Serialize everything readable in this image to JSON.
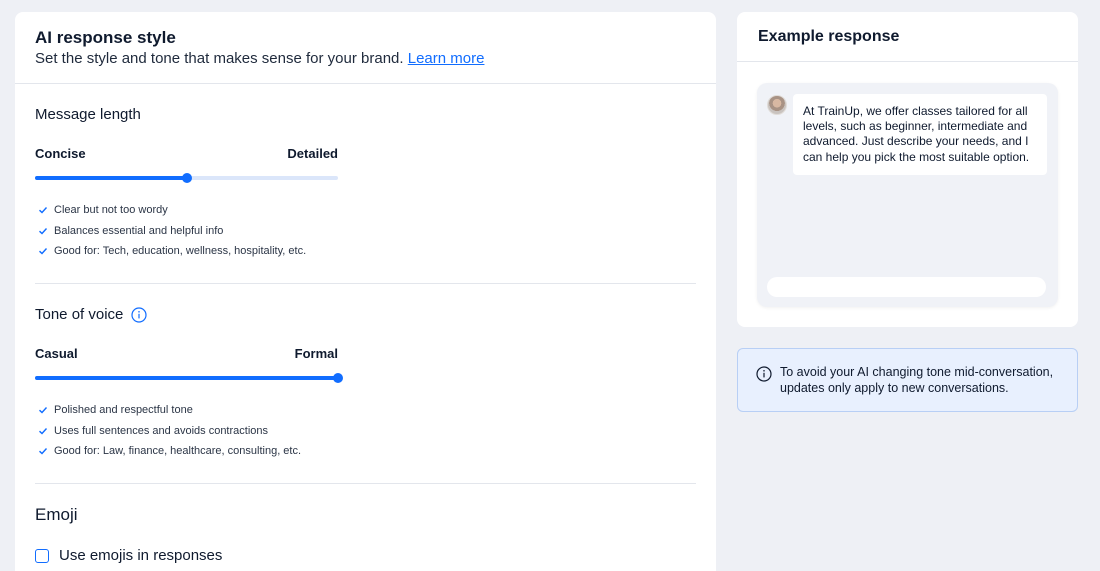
{
  "header": {
    "title": "AI response style",
    "subtitle": "Set the style and tone that makes sense for your brand.",
    "learn_more": "Learn more"
  },
  "message_length": {
    "title": "Message length",
    "min_label": "Concise",
    "max_label": "Detailed",
    "value": 0.5,
    "bullets": [
      "Clear but not too wordy",
      "Balances essential and helpful info",
      "Good for: Tech, education, wellness, hospitality, etc."
    ]
  },
  "tone_of_voice": {
    "title": "Tone of voice",
    "min_label": "Casual",
    "max_label": "Formal",
    "value": 1.0,
    "bullets": [
      "Polished and respectful tone",
      "Uses full sentences and avoids contractions",
      "Good for: Law, finance, healthcare, consulting, etc."
    ]
  },
  "emoji": {
    "title": "Emoji",
    "checkbox_label": "Use emojis in responses",
    "checked": false
  },
  "example": {
    "title": "Example response",
    "message": "At TrainUp, we offer classes tailored for all levels, such as beginner, intermediate and advanced. Just describe your needs, and I can help you pick the most suitable option."
  },
  "notice": {
    "text": "To avoid your AI changing tone mid-conversation, updates only apply to new conversations."
  },
  "colors": {
    "accent": "#116dff",
    "track": "#dbe6fa",
    "page_bg": "#eef0f5",
    "notice_bg": "#e8f0fe"
  }
}
